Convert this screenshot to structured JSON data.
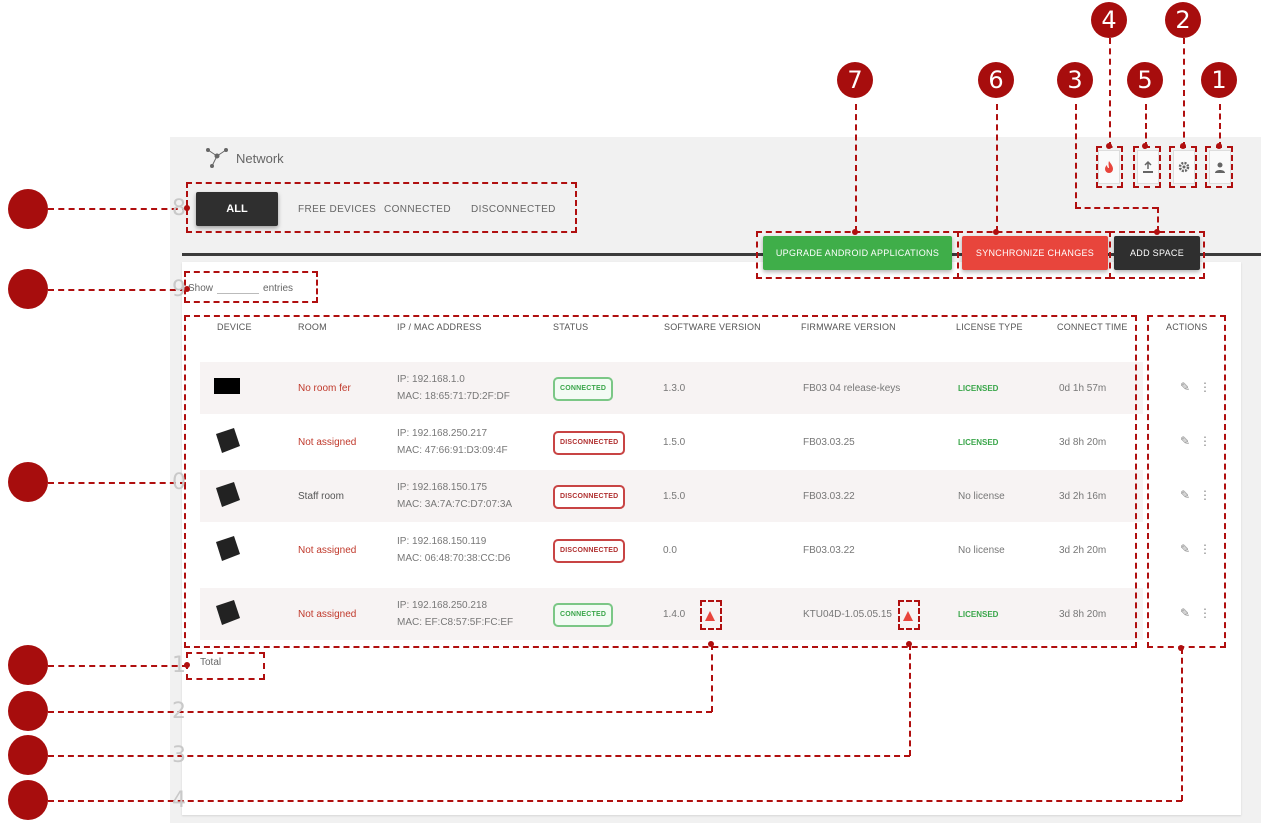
{
  "header": {
    "title": "Network",
    "logo_icon": "network-icon"
  },
  "top_icons": [
    "fire-icon",
    "export-icon",
    "gear-icon",
    "user-icon"
  ],
  "tabs": {
    "all": "ALL",
    "free": "FREE DEVICES",
    "connected": "CONNECTED",
    "disconnected": "DISCONNECTED"
  },
  "buttons": {
    "upgrade": "UPGRADE ANDROID APPLICATIONS",
    "sync": "SYNCHRONIZE CHANGES",
    "add": "ADD SPACE"
  },
  "show_entries": {
    "prefix": "Show",
    "suffix": "entries"
  },
  "columns": [
    "DEVICE",
    "ROOM",
    "IP / MAC ADDRESS",
    "STATUS",
    "SOFTWARE VERSION",
    "FIRMWARE VERSION",
    "LICENSE TYPE",
    "CONNECT TIME",
    "ACTIONS"
  ],
  "rows": [
    {
      "room": "No room fer",
      "ip": "IP: 192.168.1.0",
      "mac": "MAC: 18:65:71:7D:2F:DF",
      "status": "CONNECTED",
      "software": "1.3.0",
      "firmware": "FB03 04 release-keys",
      "license": "LICENSED",
      "time": "0d 1h 57m"
    },
    {
      "room": "Not assigned",
      "ip": "IP: 192.168.250.217",
      "mac": "MAC: 47:66:91:D3:09:4F",
      "status": "DISCONNECTED",
      "software": "1.5.0",
      "firmware": "FB03.03.25",
      "license": "LICENSED",
      "time": "3d 8h 20m"
    },
    {
      "room": "Staff room",
      "ip": "IP: 192.168.150.175",
      "mac": "MAC: 3A:7A:7C:D7:07:3A",
      "status": "DISCONNECTED",
      "software": "1.5.0",
      "firmware": "FB03.03.22",
      "license": "No license",
      "time": "3d 2h 16m"
    },
    {
      "room": "Not assigned",
      "ip": "IP: 192.168.150.119",
      "mac": "MAC: 06:48:70:38:CC:D6",
      "status": "DISCONNECTED",
      "software": "0.0",
      "firmware": "FB03.03.22",
      "license": "No license",
      "time": "3d 2h 20m"
    },
    {
      "room": "Not assigned",
      "ip": "IP: 192.168.250.218",
      "mac": "MAC: EF:C8:57:5F:FC:EF",
      "status": "CONNECTED",
      "software": "1.4.0",
      "firmware": "KTU04D-1.05.05.15",
      "license": "LICENSED",
      "time": "3d 8h 20m"
    }
  ],
  "total": "Total",
  "callouts": {
    "c7": "7",
    "c6": "6",
    "c3": "3",
    "c4": "4",
    "c5": "5",
    "c2": "2",
    "c1": "1"
  },
  "faint_labels": {
    "l8": "8",
    "l9": "9",
    "l0": "0",
    "l1": "1",
    "l2": "2",
    "l3": "3",
    "l4": "4"
  },
  "colors": {
    "annotation": "#a70d0d",
    "upgrade": "#3fae49",
    "sync": "#e8453c",
    "add": "#2f2f2f",
    "accent": "#d9534f"
  }
}
